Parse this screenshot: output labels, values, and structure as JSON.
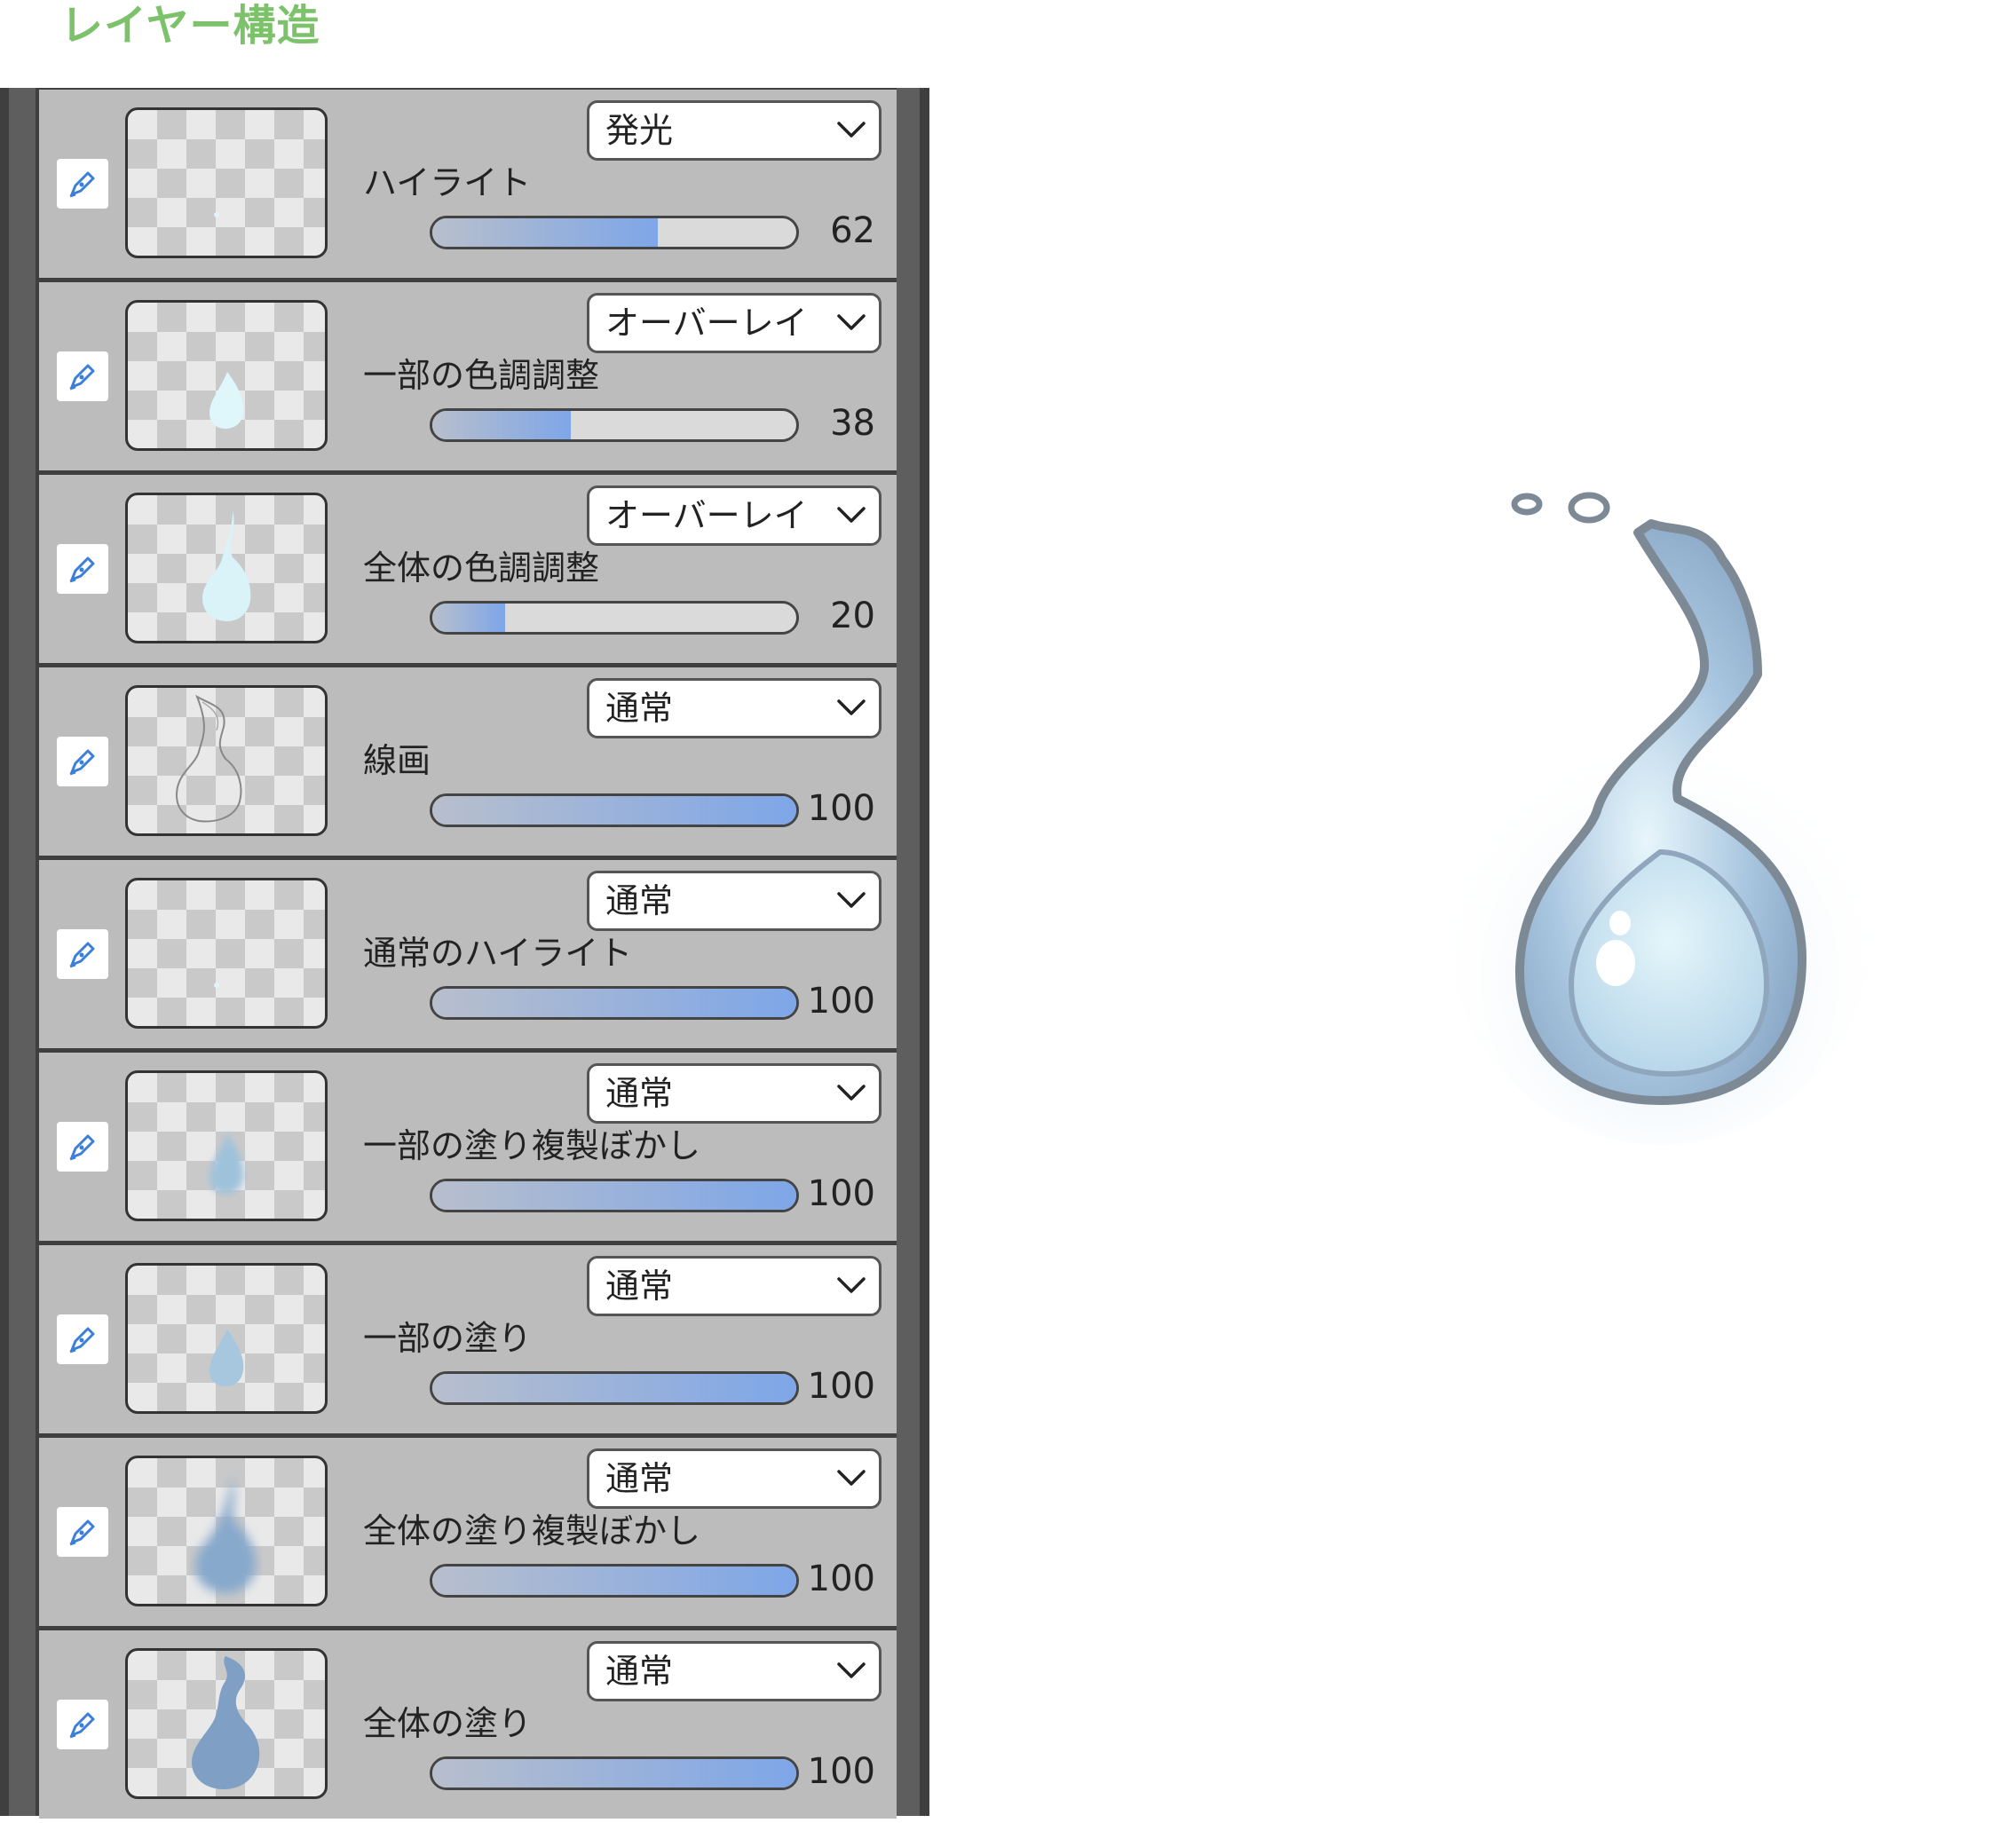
{
  "title": "レイヤー構造",
  "icons": {
    "layer_type": "pen-icon",
    "dropdown": "chevron-down-icon"
  },
  "colors": {
    "title": "#7cc26b",
    "slider_fill_end": "#7ea6e8"
  },
  "layers": [
    {
      "name": "ハイライト",
      "blend": "発光",
      "opacity": "62",
      "opacity_value": 62,
      "thumb": "dot"
    },
    {
      "name": "一部の色調調整",
      "blend": "オーバーレイ",
      "opacity": "38",
      "opacity_value": 38,
      "thumb": "drop-light"
    },
    {
      "name": "全体の色調調整",
      "blend": "オーバーレイ",
      "opacity": "20",
      "opacity_value": 20,
      "thumb": "flame-light"
    },
    {
      "name": "線画",
      "blend": "通常",
      "opacity": "100",
      "opacity_value": 100,
      "thumb": "lineart"
    },
    {
      "name": "通常のハイライト",
      "blend": "通常",
      "opacity": "100",
      "opacity_value": 100,
      "thumb": "dot"
    },
    {
      "name": "一部の塗り複製ぼかし",
      "blend": "通常",
      "opacity": "100",
      "opacity_value": 100,
      "thumb": "drop-blur"
    },
    {
      "name": "一部の塗り",
      "blend": "通常",
      "opacity": "100",
      "opacity_value": 100,
      "thumb": "drop"
    },
    {
      "name": "全体の塗り複製ぼかし",
      "blend": "通常",
      "opacity": "100",
      "opacity_value": 100,
      "thumb": "flame-blur"
    },
    {
      "name": "全体の塗り",
      "blend": "通常",
      "opacity": "100",
      "opacity_value": 100,
      "thumb": "flame"
    }
  ]
}
